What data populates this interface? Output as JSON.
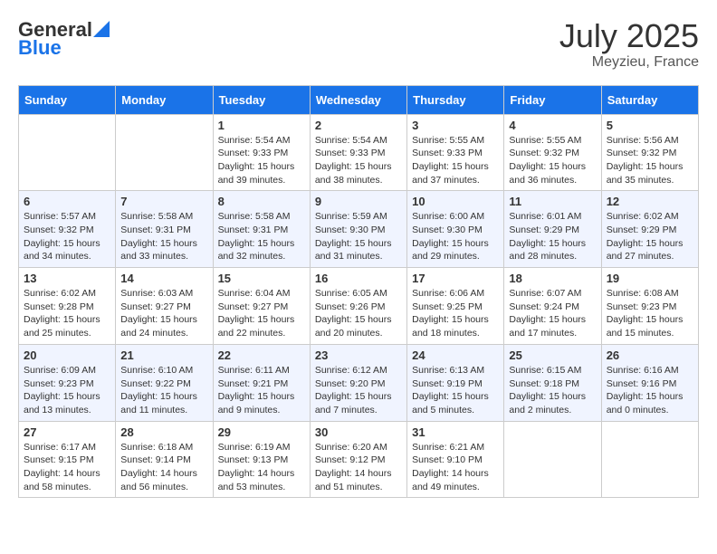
{
  "header": {
    "logo_general": "General",
    "logo_blue": "Blue",
    "month_year": "July 2025",
    "location": "Meyzieu, France"
  },
  "days_of_week": [
    "Sunday",
    "Monday",
    "Tuesday",
    "Wednesday",
    "Thursday",
    "Friday",
    "Saturday"
  ],
  "weeks": [
    [
      {
        "day": "",
        "sunrise": "",
        "sunset": "",
        "daylight": ""
      },
      {
        "day": "",
        "sunrise": "",
        "sunset": "",
        "daylight": ""
      },
      {
        "day": "1",
        "sunrise": "Sunrise: 5:54 AM",
        "sunset": "Sunset: 9:33 PM",
        "daylight": "Daylight: 15 hours and 39 minutes."
      },
      {
        "day": "2",
        "sunrise": "Sunrise: 5:54 AM",
        "sunset": "Sunset: 9:33 PM",
        "daylight": "Daylight: 15 hours and 38 minutes."
      },
      {
        "day": "3",
        "sunrise": "Sunrise: 5:55 AM",
        "sunset": "Sunset: 9:33 PM",
        "daylight": "Daylight: 15 hours and 37 minutes."
      },
      {
        "day": "4",
        "sunrise": "Sunrise: 5:55 AM",
        "sunset": "Sunset: 9:32 PM",
        "daylight": "Daylight: 15 hours and 36 minutes."
      },
      {
        "day": "5",
        "sunrise": "Sunrise: 5:56 AM",
        "sunset": "Sunset: 9:32 PM",
        "daylight": "Daylight: 15 hours and 35 minutes."
      }
    ],
    [
      {
        "day": "6",
        "sunrise": "Sunrise: 5:57 AM",
        "sunset": "Sunset: 9:32 PM",
        "daylight": "Daylight: 15 hours and 34 minutes."
      },
      {
        "day": "7",
        "sunrise": "Sunrise: 5:58 AM",
        "sunset": "Sunset: 9:31 PM",
        "daylight": "Daylight: 15 hours and 33 minutes."
      },
      {
        "day": "8",
        "sunrise": "Sunrise: 5:58 AM",
        "sunset": "Sunset: 9:31 PM",
        "daylight": "Daylight: 15 hours and 32 minutes."
      },
      {
        "day": "9",
        "sunrise": "Sunrise: 5:59 AM",
        "sunset": "Sunset: 9:30 PM",
        "daylight": "Daylight: 15 hours and 31 minutes."
      },
      {
        "day": "10",
        "sunrise": "Sunrise: 6:00 AM",
        "sunset": "Sunset: 9:30 PM",
        "daylight": "Daylight: 15 hours and 29 minutes."
      },
      {
        "day": "11",
        "sunrise": "Sunrise: 6:01 AM",
        "sunset": "Sunset: 9:29 PM",
        "daylight": "Daylight: 15 hours and 28 minutes."
      },
      {
        "day": "12",
        "sunrise": "Sunrise: 6:02 AM",
        "sunset": "Sunset: 9:29 PM",
        "daylight": "Daylight: 15 hours and 27 minutes."
      }
    ],
    [
      {
        "day": "13",
        "sunrise": "Sunrise: 6:02 AM",
        "sunset": "Sunset: 9:28 PM",
        "daylight": "Daylight: 15 hours and 25 minutes."
      },
      {
        "day": "14",
        "sunrise": "Sunrise: 6:03 AM",
        "sunset": "Sunset: 9:27 PM",
        "daylight": "Daylight: 15 hours and 24 minutes."
      },
      {
        "day": "15",
        "sunrise": "Sunrise: 6:04 AM",
        "sunset": "Sunset: 9:27 PM",
        "daylight": "Daylight: 15 hours and 22 minutes."
      },
      {
        "day": "16",
        "sunrise": "Sunrise: 6:05 AM",
        "sunset": "Sunset: 9:26 PM",
        "daylight": "Daylight: 15 hours and 20 minutes."
      },
      {
        "day": "17",
        "sunrise": "Sunrise: 6:06 AM",
        "sunset": "Sunset: 9:25 PM",
        "daylight": "Daylight: 15 hours and 18 minutes."
      },
      {
        "day": "18",
        "sunrise": "Sunrise: 6:07 AM",
        "sunset": "Sunset: 9:24 PM",
        "daylight": "Daylight: 15 hours and 17 minutes."
      },
      {
        "day": "19",
        "sunrise": "Sunrise: 6:08 AM",
        "sunset": "Sunset: 9:23 PM",
        "daylight": "Daylight: 15 hours and 15 minutes."
      }
    ],
    [
      {
        "day": "20",
        "sunrise": "Sunrise: 6:09 AM",
        "sunset": "Sunset: 9:23 PM",
        "daylight": "Daylight: 15 hours and 13 minutes."
      },
      {
        "day": "21",
        "sunrise": "Sunrise: 6:10 AM",
        "sunset": "Sunset: 9:22 PM",
        "daylight": "Daylight: 15 hours and 11 minutes."
      },
      {
        "day": "22",
        "sunrise": "Sunrise: 6:11 AM",
        "sunset": "Sunset: 9:21 PM",
        "daylight": "Daylight: 15 hours and 9 minutes."
      },
      {
        "day": "23",
        "sunrise": "Sunrise: 6:12 AM",
        "sunset": "Sunset: 9:20 PM",
        "daylight": "Daylight: 15 hours and 7 minutes."
      },
      {
        "day": "24",
        "sunrise": "Sunrise: 6:13 AM",
        "sunset": "Sunset: 9:19 PM",
        "daylight": "Daylight: 15 hours and 5 minutes."
      },
      {
        "day": "25",
        "sunrise": "Sunrise: 6:15 AM",
        "sunset": "Sunset: 9:18 PM",
        "daylight": "Daylight: 15 hours and 2 minutes."
      },
      {
        "day": "26",
        "sunrise": "Sunrise: 6:16 AM",
        "sunset": "Sunset: 9:16 PM",
        "daylight": "Daylight: 15 hours and 0 minutes."
      }
    ],
    [
      {
        "day": "27",
        "sunrise": "Sunrise: 6:17 AM",
        "sunset": "Sunset: 9:15 PM",
        "daylight": "Daylight: 14 hours and 58 minutes."
      },
      {
        "day": "28",
        "sunrise": "Sunrise: 6:18 AM",
        "sunset": "Sunset: 9:14 PM",
        "daylight": "Daylight: 14 hours and 56 minutes."
      },
      {
        "day": "29",
        "sunrise": "Sunrise: 6:19 AM",
        "sunset": "Sunset: 9:13 PM",
        "daylight": "Daylight: 14 hours and 53 minutes."
      },
      {
        "day": "30",
        "sunrise": "Sunrise: 6:20 AM",
        "sunset": "Sunset: 9:12 PM",
        "daylight": "Daylight: 14 hours and 51 minutes."
      },
      {
        "day": "31",
        "sunrise": "Sunrise: 6:21 AM",
        "sunset": "Sunset: 9:10 PM",
        "daylight": "Daylight: 14 hours and 49 minutes."
      },
      {
        "day": "",
        "sunrise": "",
        "sunset": "",
        "daylight": ""
      },
      {
        "day": "",
        "sunrise": "",
        "sunset": "",
        "daylight": ""
      }
    ]
  ]
}
